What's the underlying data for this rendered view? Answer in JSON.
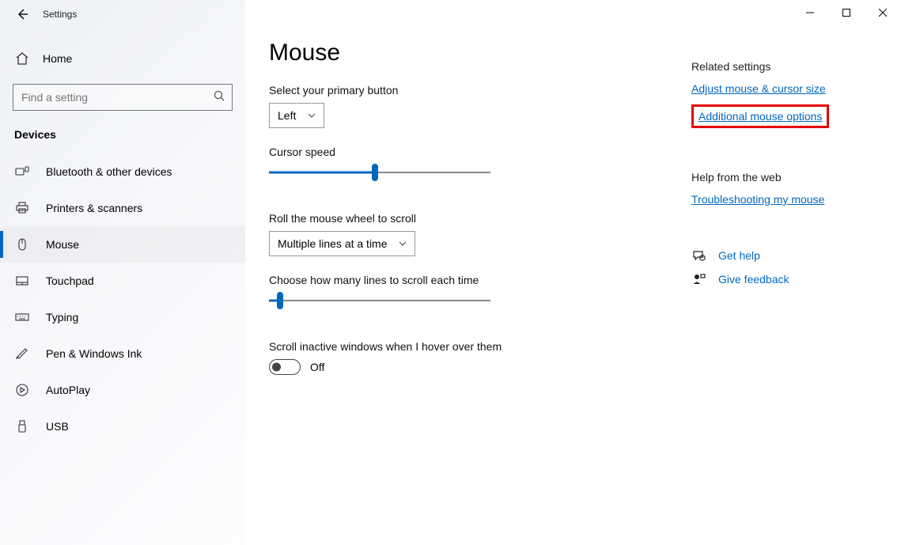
{
  "app_title": "Settings",
  "home_label": "Home",
  "search_placeholder": "Find a setting",
  "category": "Devices",
  "nav": {
    "items": [
      {
        "label": "Bluetooth & other devices"
      },
      {
        "label": "Printers & scanners"
      },
      {
        "label": "Mouse"
      },
      {
        "label": "Touchpad"
      },
      {
        "label": "Typing"
      },
      {
        "label": "Pen & Windows Ink"
      },
      {
        "label": "AutoPlay"
      },
      {
        "label": "USB"
      }
    ],
    "active_index": 2
  },
  "page": {
    "title": "Mouse",
    "primary_button": {
      "label": "Select your primary button",
      "value": "Left"
    },
    "cursor_speed": {
      "label": "Cursor speed",
      "percent": 48
    },
    "wheel_scroll": {
      "label": "Roll the mouse wheel to scroll",
      "value": "Multiple lines at a time"
    },
    "lines_each": {
      "label": "Choose how many lines to scroll each time",
      "percent": 5
    },
    "inactive": {
      "label": "Scroll inactive windows when I hover over them",
      "state": "Off"
    }
  },
  "side": {
    "related_heading": "Related settings",
    "link_adjust": "Adjust mouse & cursor size",
    "link_additional": "Additional mouse options",
    "help_heading": "Help from the web",
    "link_troubleshoot": "Troubleshooting my mouse",
    "get_help": "Get help",
    "give_feedback": "Give feedback"
  }
}
